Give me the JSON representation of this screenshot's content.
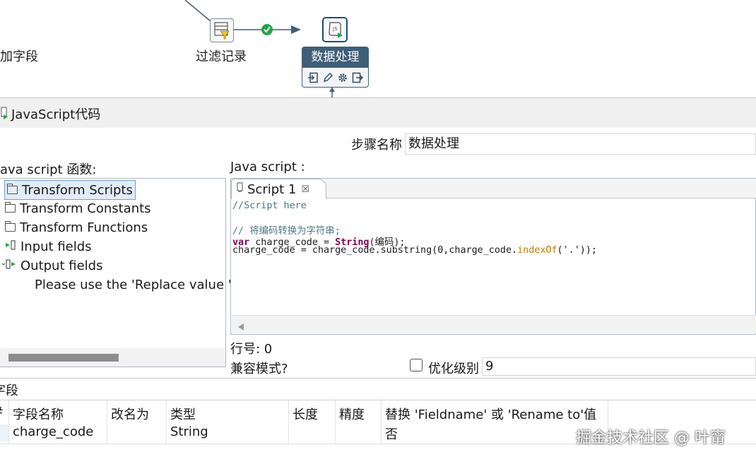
{
  "canvas": {
    "node_left_label": "加字段",
    "node_filter_label": "过滤记录",
    "node_process_label": "数据处理",
    "popup_title": "数据处理",
    "hop_color": "#22a745"
  },
  "dialog": {
    "title": "JavaScript代码",
    "step_name_label": "步骤名称",
    "step_name_value": "数据处理",
    "functions_label": "ava script 函数:",
    "script_label": "Java script :",
    "tree": {
      "items": [
        {
          "label": "Transform Scripts",
          "icon": "folder-icon"
        },
        {
          "label": "Transform Constants",
          "icon": "folder-icon"
        },
        {
          "label": "Transform Functions",
          "icon": "folder-icon"
        },
        {
          "label": "Input fields",
          "icon": "input-fields-icon"
        },
        {
          "label": "Output fields",
          "icon": "output-fields-icon"
        }
      ],
      "note": "Please use the 'Replace value 'Fi"
    },
    "editor": {
      "tab_label": "Script 1",
      "code_line_1": "//Script here",
      "code_line_3": "// 将编码转换为字符串;",
      "code_line_4_kw": "var",
      "code_line_4_mid": " charge_code = ",
      "code_line_4_type": "String",
      "code_line_4_end": "(编码);",
      "code_line_5_start": "charge_code = charge_code.substring(0,charge_code.",
      "code_line_5_fn": "indexOf",
      "code_line_5_end": "('.'));"
    },
    "line_number_label": "行号: 0",
    "compat_mode_label": "兼容模式?",
    "optimization_label": "优化级别",
    "optimization_value": "9",
    "fields_section_label": "字段",
    "table": {
      "headers": [
        "字段名称",
        "改名为",
        "类型",
        "长度",
        "精度",
        "替换 'Fieldname' 或 'Rename to'值"
      ],
      "row": {
        "field_name": "charge_code",
        "rename_to": "",
        "type": "String",
        "length": "",
        "precision": "",
        "replace": "否"
      },
      "row_number_header": "#"
    }
  },
  "watermark": "掘金技术社区 @ 叶甯"
}
